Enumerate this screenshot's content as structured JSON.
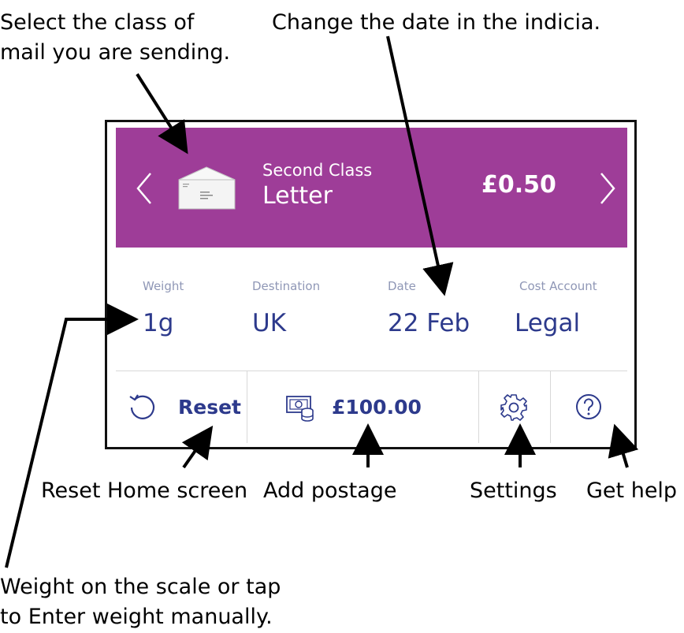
{
  "callouts": {
    "class_line1": "Select the class of",
    "class_line2": "mail you are sending.",
    "date": "Change the date in the indicia.",
    "reset": "Reset Home screen",
    "postage": "Add postage",
    "settings": "Settings",
    "help": "Get help",
    "weight_line1": "Weight on the scale or tap",
    "weight_line2": "to Enter weight manually."
  },
  "header": {
    "class_name": "Second Class",
    "mail_type": "Letter",
    "price": "£0.50",
    "prev_icon": "chevron-left-icon",
    "next_icon": "chevron-right-icon",
    "envelope_icon": "envelope-icon",
    "background": "#9e3d98"
  },
  "info": {
    "weight": {
      "label": "Weight",
      "value": "1g"
    },
    "destination": {
      "label": "Destination",
      "value": "UK"
    },
    "date": {
      "label": "Date",
      "value": "22 Feb"
    },
    "cost_account": {
      "label": "Cost Account",
      "value": "Legal"
    }
  },
  "buttons": {
    "reset": {
      "label": "Reset",
      "icon": "reset-icon"
    },
    "postage": {
      "label": "£100.00",
      "icon": "money-icon"
    },
    "settings": {
      "icon": "gear-icon"
    },
    "help": {
      "icon": "help-icon"
    }
  },
  "colors": {
    "accent": "#9e3d98",
    "value_text": "#2d3a8c",
    "label_text": "#8f97b6"
  }
}
